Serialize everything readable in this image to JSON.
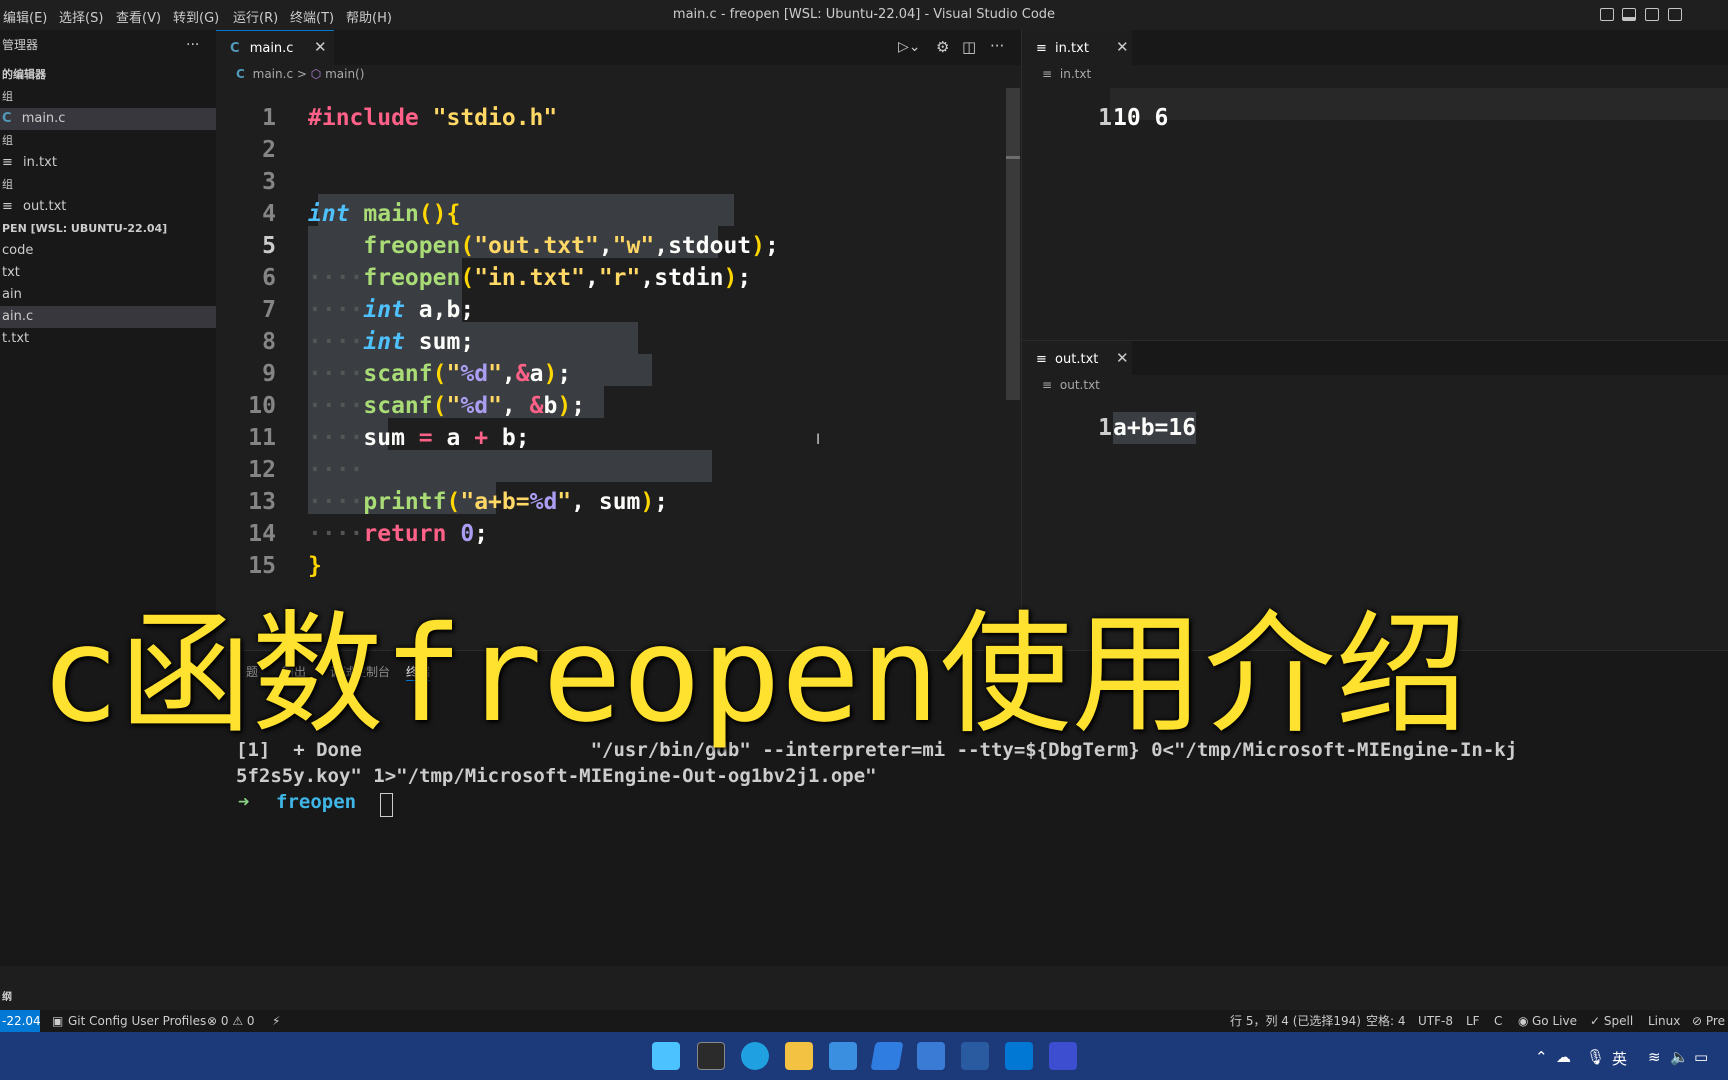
{
  "titlebar": {
    "menus": [
      "编辑(E)",
      "选择(S)",
      "查看(V)",
      "转到(G)",
      "运行(R)",
      "终端(T)",
      "帮助(H)"
    ],
    "title": "main.c - freopen [WSL: Ubuntu-22.04] - Visual Studio Code"
  },
  "sidebar": {
    "header": "管理器",
    "more": "···",
    "open_editors_label": "的编辑器",
    "group1": "组",
    "item_main": "main.c",
    "group2": "组",
    "item_in": "in.txt",
    "group3": "组",
    "item_out": "out.txt",
    "workspace_label": "PEN [WSL: UBUNTU-22.04]",
    "folder_items": [
      "code",
      "txt",
      "ain",
      "ain.c",
      "t.txt"
    ],
    "bottom_label": "纲"
  },
  "editor": {
    "tab_label": "main.c",
    "tab_icon": "C",
    "tab_close": "✕",
    "breadcrumb_file": "main.c",
    "breadcrumb_sep": ">",
    "breadcrumb_func": "main()",
    "breadcrumb_icon": "C",
    "line_numbers": [
      "1",
      "2",
      "3",
      "4",
      "5",
      "6",
      "7",
      "8",
      "9",
      "10",
      "11",
      "12",
      "13",
      "14",
      "15"
    ]
  },
  "in_panel": {
    "tab_label": "in.txt",
    "tab_close": "✕",
    "breadcrumb": "in.txt",
    "line_number": "1",
    "content": "10 6"
  },
  "out_panel": {
    "tab_label": "out.txt",
    "tab_close": "✕",
    "breadcrumb": "out.txt",
    "line_number": "1",
    "content": "a+b=16"
  },
  "terminal": {
    "tabs": [
      "题",
      "输出",
      "调试控制台",
      "终端"
    ],
    "line1": "[1]  + Done                    \"/usr/bin/gdb\" --interpreter=mi --tty=${DbgTerm} 0<\"/tmp/Microsoft-MIEngine-In-kj",
    "line2": "5f2s5y.koy\" 1>\"/tmp/Microsoft-MIEngine-Out-og1bv2j1.ope\"",
    "prompt_arrow": "➜",
    "prompt_dir": "freopen"
  },
  "overlay": {
    "caption": "c函数freopen使用介绍"
  },
  "statusbar": {
    "remote": "-22.04",
    "git_profiles": "Git Config User Profiles",
    "problems": "⊗ 0 ⚠ 0",
    "cursor": "行 5，列 4 (已选择194)",
    "spaces": "空格: 4",
    "encoding": "UTF-8",
    "eol": "LF",
    "language": "C",
    "go_live": "Go Live",
    "spell": "✓ Spell",
    "os": "Linux",
    "prettier": "⊘ Pre"
  },
  "taskbar": {
    "ime": "英"
  },
  "colors": {
    "accent": "#0078d4",
    "taskbar": "#1c3a7a",
    "overlay_text": "#ffe12f"
  }
}
